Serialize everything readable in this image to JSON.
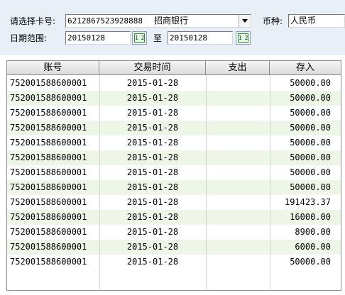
{
  "filters": {
    "card_label": "请选择卡号:",
    "card_number": "6212867523928888",
    "card_bank": "招商银行",
    "currency_label": "币种:",
    "currency_value": "人民币",
    "date_label": "日期范围:",
    "date_from": "20150128",
    "date_sep": "至",
    "date_to": "20150128",
    "calendar_icon_text": "1 2"
  },
  "table": {
    "columns": [
      "账号",
      "交易时间",
      "支出",
      "存入"
    ],
    "rows": [
      {
        "account": "752001588600001",
        "time": "2015-01-28",
        "out": "",
        "in": "50000.00"
      },
      {
        "account": "752001588600001",
        "time": "2015-01-28",
        "out": "",
        "in": "50000.00"
      },
      {
        "account": "752001588600001",
        "time": "2015-01-28",
        "out": "",
        "in": "50000.00"
      },
      {
        "account": "752001588600001",
        "time": "2015-01-28",
        "out": "",
        "in": "50000.00"
      },
      {
        "account": "752001588600001",
        "time": "2015-01-28",
        "out": "",
        "in": "50000.00"
      },
      {
        "account": "752001588600001",
        "time": "2015-01-28",
        "out": "",
        "in": "50000.00"
      },
      {
        "account": "752001588600001",
        "time": "2015-01-28",
        "out": "",
        "in": "50000.00"
      },
      {
        "account": "752001588600001",
        "time": "2015-01-28",
        "out": "",
        "in": "50000.00"
      },
      {
        "account": "752001588600001",
        "time": "2015-01-28",
        "out": "",
        "in": "191423.37"
      },
      {
        "account": "752001588600001",
        "time": "2015-01-28",
        "out": "",
        "in": "16000.00"
      },
      {
        "account": "752001588600001",
        "time": "2015-01-28",
        "out": "",
        "in": "8900.00"
      },
      {
        "account": "752001588600001",
        "time": "2015-01-28",
        "out": "",
        "in": "6000.00"
      },
      {
        "account": "752001588600001",
        "time": "2015-01-28",
        "out": "",
        "in": "50000.00"
      }
    ]
  },
  "colors": {
    "toolbar_bg": "#e8eff7",
    "row_alt_bg": "#eef6e8",
    "calendar_green": "#2e8b2e"
  }
}
